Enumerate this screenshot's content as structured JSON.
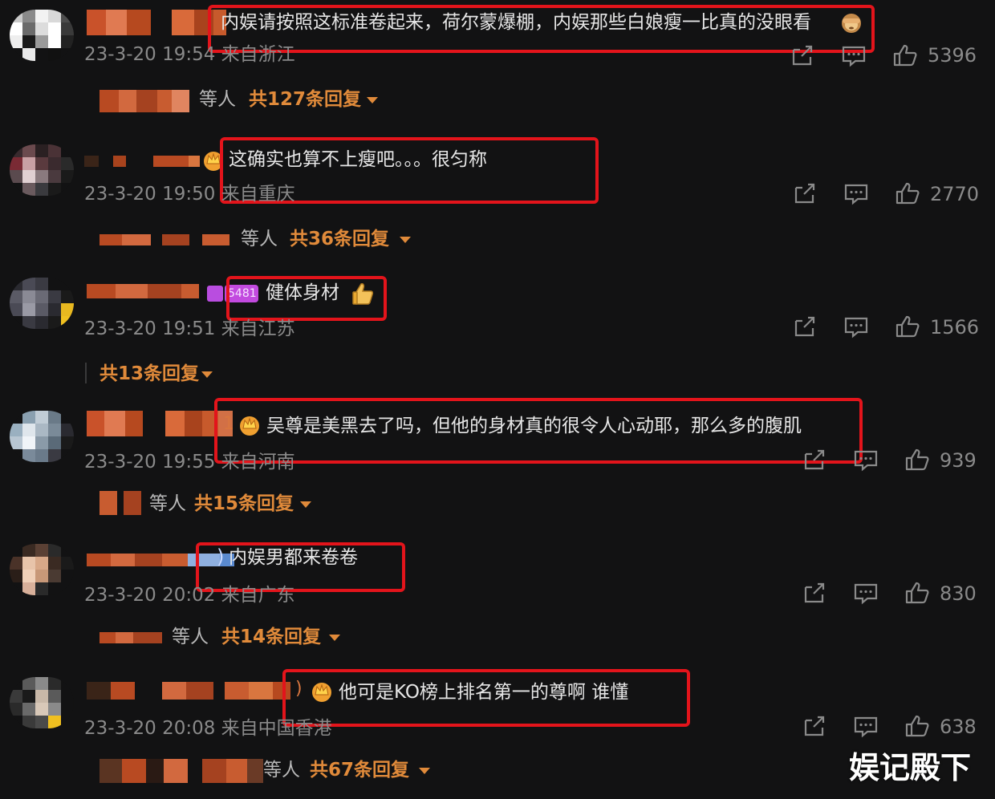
{
  "reply_prefix": "等人",
  "comments": [
    {
      "text": "内娱请按照这标准卷起来，荷尔蒙爆棚，内娱那些白娘瘦一比真的没眼看",
      "time": "23-3-20 19:54 来自浙江",
      "likes": "5396",
      "replies": "共127条回复",
      "emoji": "see-no-evil-monkey-icon"
    },
    {
      "text": "这确实也算不上瘦吧。。。很匀称",
      "time": "23-3-20 19:50 来自重庆",
      "likes": "2770",
      "replies": "共36条回复",
      "badge_icon": "crown-icon"
    },
    {
      "text": "健体身材",
      "time": "23-3-20 19:51 来自江苏",
      "likes": "1566",
      "replies": "共13条回复",
      "badge": "5481",
      "emoji": "thumbs-up-emoji-icon"
    },
    {
      "text": "吴尊是美黑去了吗，但他的身材真的很令人心动耶，那么多的腹肌",
      "time": "23-3-20 19:55 来自河南",
      "likes": "939",
      "replies": "共15条回复",
      "badge_icon": "crown-icon"
    },
    {
      "text": "内娱男都来卷卷",
      "time": "23-3-20 20:02 来自广东",
      "likes": "830",
      "replies": "共14条回复"
    },
    {
      "text": "他可是KO榜上排名第一的尊啊 谁懂",
      "time": "23-3-20 20:08 来自中国香港",
      "likes": "638",
      "replies": "共67条回复",
      "badge_icon": "crown-icon"
    }
  ],
  "watermark": "娱记殿下",
  "colors": {
    "background": "#121213",
    "highlight_box": "#e3141b",
    "reply_accent": "#e08a3a",
    "muted_text": "#8a8a8a",
    "body_text": "#e6e6e6"
  }
}
